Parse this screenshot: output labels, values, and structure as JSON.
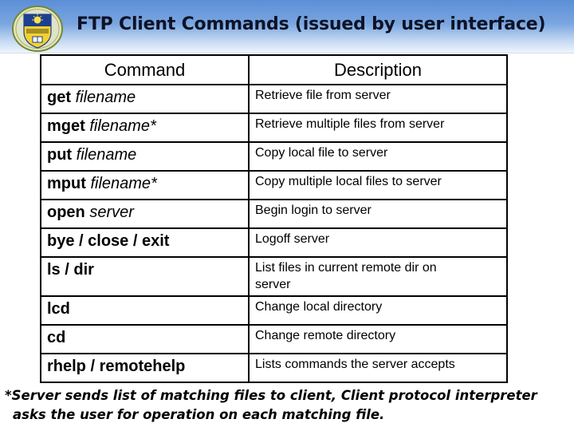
{
  "slide": {
    "title": "FTP Client Commands (issued by user interface)",
    "logo_icon": "university-crest-icon",
    "colors": {
      "header_top": "#5b8fd6",
      "header_bottom": "#eef4fc",
      "title_text": "#0d1326",
      "crest_blue": "#1d3f8f",
      "crest_gold": "#f2d230"
    }
  },
  "table": {
    "headers": [
      "Command",
      "Description"
    ],
    "rows": [
      {
        "command": "get",
        "argument": "filename",
        "description": "Retrieve file from server"
      },
      {
        "command": "mget",
        "argument": "filename*",
        "description": "Retrieve multiple files from server"
      },
      {
        "command": "put",
        "argument": "filename",
        "description": "Copy local file to server"
      },
      {
        "command": "mput",
        "argument": "filename*",
        "description": "Copy multiple local files to server"
      },
      {
        "command": "open",
        "argument": "server",
        "description": "Begin login to server"
      },
      {
        "command": "bye / close / exit",
        "argument": "",
        "description": "Logoff server"
      },
      {
        "command": "ls / dir",
        "argument": "",
        "description": "List files in current remote dir on server"
      },
      {
        "command": "lcd",
        "argument": "",
        "description": "Change local directory"
      },
      {
        "command": "cd",
        "argument": "",
        "description": "Change remote directory"
      },
      {
        "command": "rhelp / remotehelp",
        "argument": "",
        "description": "Lists commands the server accepts"
      }
    ]
  },
  "footnote": {
    "line1": "*Server sends list of matching files to client, Client protocol interpreter",
    "line2": "asks the user for operation on each matching file."
  }
}
